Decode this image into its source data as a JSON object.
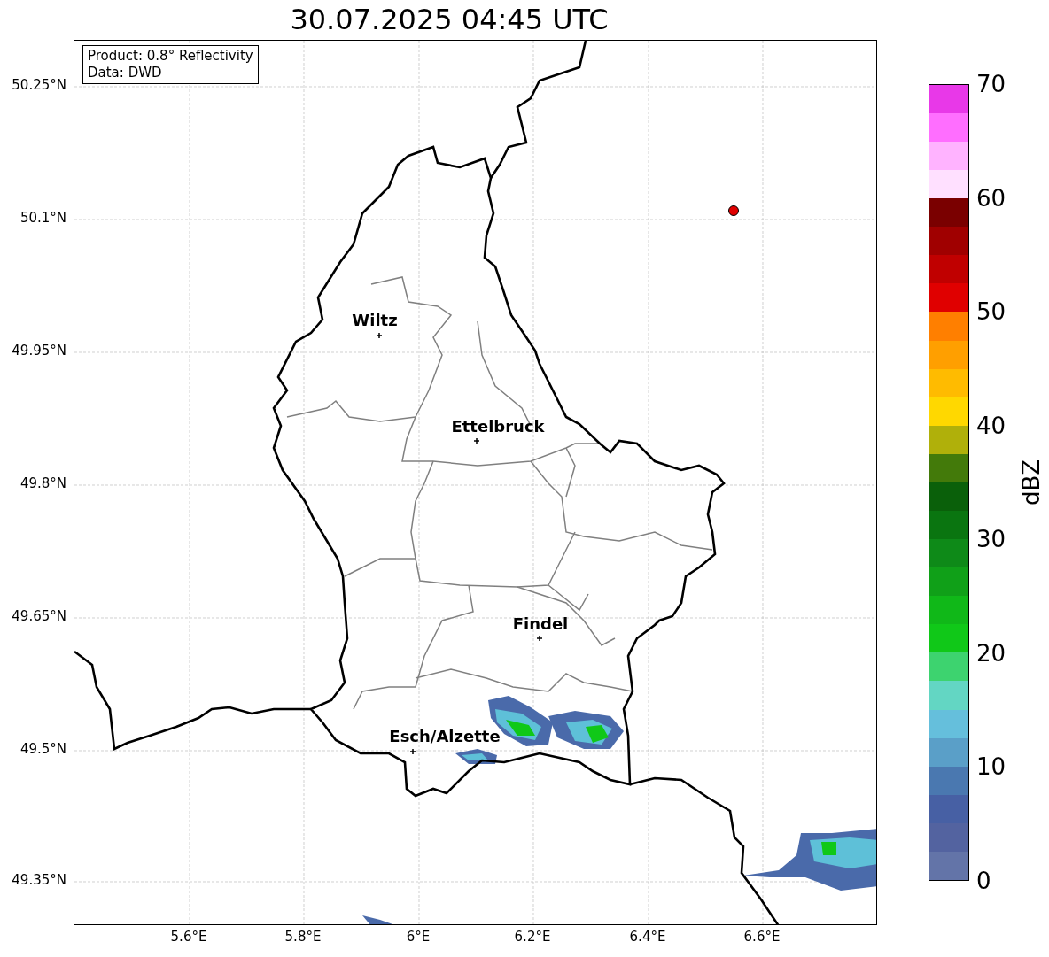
{
  "title": "30.07.2025 04:45 UTC",
  "info_box": [
    "Product: 0.8° Reflectivity",
    "Data: DWD"
  ],
  "map": {
    "y_ticks": [
      "50.25°N",
      "50.1°N",
      "49.95°N",
      "49.8°N",
      "49.65°N",
      "49.5°N",
      "49.35°N"
    ],
    "x_ticks": [
      "5.6°E",
      "5.8°E",
      "6°E",
      "6.2°E",
      "6.4°E",
      "6.6°E"
    ],
    "places": [
      {
        "name": "Wiltz"
      },
      {
        "name": "Ettelbruck"
      },
      {
        "name": "Findel"
      },
      {
        "name": "Esch/Alzette"
      }
    ]
  },
  "colorbar": {
    "label": "dBZ",
    "ticks": [
      "70",
      "60",
      "50",
      "40",
      "30",
      "20",
      "10",
      "0"
    ],
    "segments": [
      {
        "color": "#6374a8"
      },
      {
        "color": "#5363a0"
      },
      {
        "color": "#4760a4"
      },
      {
        "color": "#4a78b0"
      },
      {
        "color": "#5a9fc8"
      },
      {
        "color": "#65bfdc"
      },
      {
        "color": "#63d6c3"
      },
      {
        "color": "#3dd36f"
      },
      {
        "color": "#10c818"
      },
      {
        "color": "#10b818"
      },
      {
        "color": "#10a018"
      },
      {
        "color": "#0e8a18"
      },
      {
        "color": "#0a7510"
      },
      {
        "color": "#0a600a"
      },
      {
        "color": "#437a0a"
      },
      {
        "color": "#b0b00a"
      },
      {
        "color": "#ffd800"
      },
      {
        "color": "#ffbb00"
      },
      {
        "color": "#ff9f00"
      },
      {
        "color": "#ff7f00"
      },
      {
        "color": "#e00000"
      },
      {
        "color": "#c00000"
      },
      {
        "color": "#a00000"
      },
      {
        "color": "#7a0000"
      },
      {
        "color": "#ffe0ff"
      },
      {
        "color": "#ffb3ff"
      },
      {
        "color": "#ff6eff"
      },
      {
        "color": "#e838e8"
      }
    ]
  }
}
